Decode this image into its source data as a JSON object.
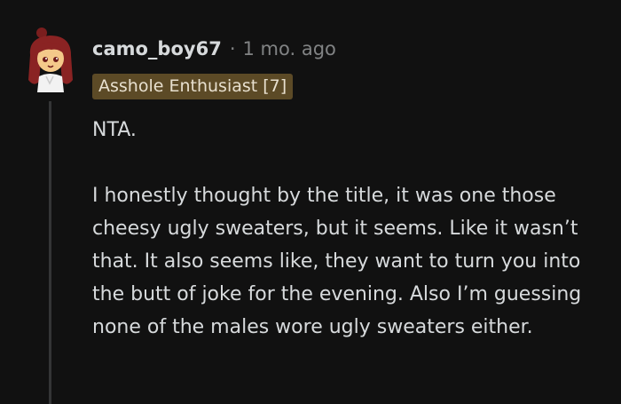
{
  "comment": {
    "author": "camo_boy67",
    "separator": "·",
    "timestamp": "1 mo. ago",
    "flair": "Asshole Enthusiast [7]",
    "paragraphs": [
      "NTA.",
      "I honestly thought by the title, it was one those cheesy ugly sweaters, but it seems. Like it wasn’t that. It also seems like, they want to turn you into the butt of joke for the evening. Also I’m guessing none of the males wore ugly sweaters either."
    ]
  },
  "colors": {
    "background": "#111111",
    "text": "#d7dadc",
    "muted": "#818384",
    "flair_bg": "#5c4a26",
    "thread_line": "#343536"
  }
}
